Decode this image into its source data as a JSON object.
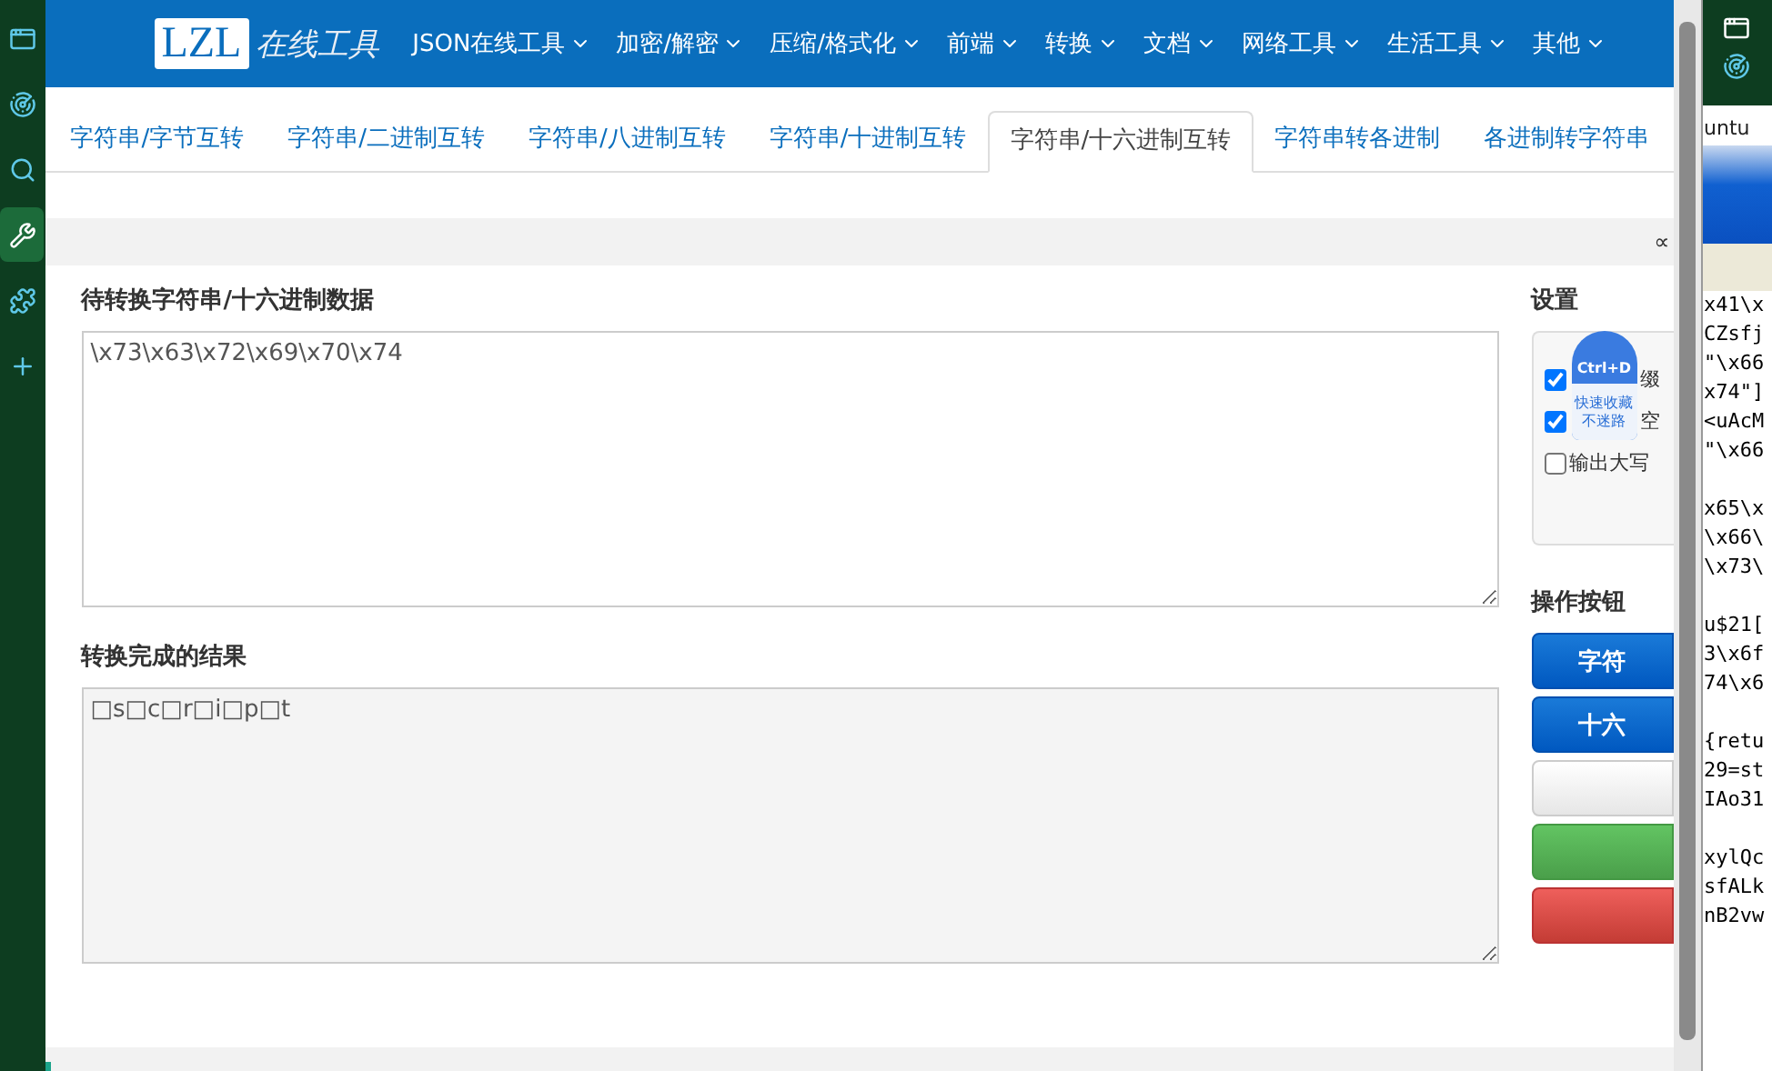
{
  "browser_sidebar": {
    "items": [
      {
        "kind": "window",
        "selected": false
      },
      {
        "kind": "radar",
        "selected": false
      },
      {
        "kind": "search",
        "selected": false
      },
      {
        "kind": "tools",
        "selected": true
      },
      {
        "kind": "puzzle",
        "selected": false
      },
      {
        "kind": "add",
        "selected": false
      }
    ]
  },
  "header": {
    "logo": {
      "mark": "LZL",
      "text": "在线工具"
    },
    "nav": [
      {
        "label": "JSON在线工具"
      },
      {
        "label": "加密/解密"
      },
      {
        "label": "压缩/格式化"
      },
      {
        "label": "前端"
      },
      {
        "label": "转换"
      },
      {
        "label": "文档"
      },
      {
        "label": "网络工具"
      },
      {
        "label": "生活工具"
      },
      {
        "label": "其他"
      }
    ]
  },
  "tabs": [
    {
      "label": "字符串/字节互转",
      "selected": false
    },
    {
      "label": "字符串/二进制互转",
      "selected": false
    },
    {
      "label": "字符串/八进制互转",
      "selected": false
    },
    {
      "label": "字符串/十进制互转",
      "selected": false
    },
    {
      "label": "字符串/十六进制互转",
      "selected": true
    },
    {
      "label": "字符串转各进制",
      "selected": false
    },
    {
      "label": "各进制转字符串",
      "selected": false
    }
  ],
  "toolbar": {
    "corner_text": "∝"
  },
  "input": {
    "label": "待转换字符串/十六进制数据",
    "value": "\\x73\\x63\\x72\\x69\\x70\\x74"
  },
  "output": {
    "label": "转换完成的结果",
    "value": "□s□c□r□i□p□t"
  },
  "settings": {
    "title": "设置",
    "options": [
      {
        "label": "缀",
        "checked": true
      },
      {
        "label": "空",
        "checked": true
      },
      {
        "label": "输出大写",
        "checked": false
      }
    ]
  },
  "bookmark_badge": {
    "shortcut": "Ctrl+D",
    "line_1": "快速收藏",
    "line_2": "不迷路"
  },
  "actions": {
    "title": "操作按钮",
    "buttons": [
      {
        "label": "字符",
        "kind": "primary"
      },
      {
        "label": "十六",
        "kind": "primary"
      },
      {
        "kind": "default"
      },
      {
        "kind": "success"
      },
      {
        "kind": "danger"
      }
    ]
  },
  "side_window": {
    "title": "untu",
    "code_blocks": [
      [
        "x41\\x",
        "CZsfj",
        "\"\\x66",
        "x74\"]",
        "<uAcM",
        "\"\\x66"
      ],
      [
        "x65\\x",
        "\\x66\\",
        "\\x73\\"
      ],
      [
        "u$21[",
        "3\\x6f",
        "74\\x6"
      ],
      [
        "{retu",
        "29=st",
        "IAo31"
      ],
      [
        "xylQc",
        "sfALk",
        "nB2vw"
      ]
    ]
  }
}
